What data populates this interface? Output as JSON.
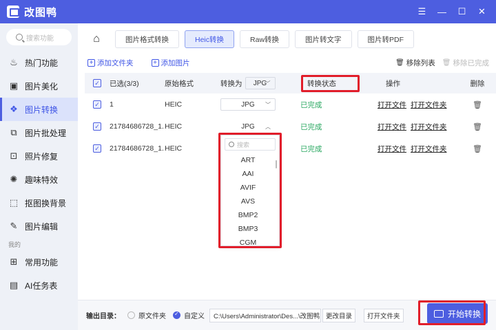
{
  "titlebar": {
    "title": "改图鸭",
    "icons": [
      "menu-icon",
      "minimize-icon",
      "maximize-icon",
      "close-icon"
    ]
  },
  "sidebar": {
    "search_placeholder": "搜索功能",
    "items": [
      {
        "label": "热门功能",
        "icon": "fire-icon"
      },
      {
        "label": "图片美化",
        "icon": "image-icon"
      },
      {
        "label": "图片转换",
        "icon": "convert-icon",
        "active": true
      },
      {
        "label": "图片批处理",
        "icon": "batch-icon"
      },
      {
        "label": "照片修复",
        "icon": "repair-icon"
      },
      {
        "label": "趣味特效",
        "icon": "effects-icon"
      },
      {
        "label": "抠图换背景",
        "icon": "cutout-icon"
      },
      {
        "label": "图片编辑",
        "icon": "edit-icon"
      }
    ],
    "group_label": "我的",
    "my_items": [
      {
        "label": "常用功能",
        "icon": "grid-icon"
      },
      {
        "label": "AI任务表",
        "icon": "task-icon"
      }
    ]
  },
  "tabs": [
    "图片格式转换",
    "Heic转换",
    "Raw转换",
    "图片转文字",
    "图片转PDF"
  ],
  "active_tab": "Heic转换",
  "toolbar": {
    "add_folder": "添加文件夹",
    "add_image": "添加图片",
    "remove_list": "移除列表",
    "remove_done": "移除已完成"
  },
  "table": {
    "headers": {
      "selected": "已选(3/3)",
      "orig_format": "原始格式",
      "convert_to": "转换为",
      "convert_to_value": "JPG",
      "status": "转换状态",
      "ops": "操作",
      "delete": "删除"
    },
    "rows": [
      {
        "name": "1",
        "format": "HEIC",
        "target": "JPG",
        "status": "已完成",
        "op1": "打开文件",
        "op2": "打开文件夹"
      },
      {
        "name": "21784686728_1...",
        "format": "HEIC",
        "target": "JPG",
        "status": "已完成",
        "op1": "打开文件",
        "op2": "打开文件夹"
      },
      {
        "name": "21784686728_1...",
        "format": "HEIC",
        "target": "",
        "status": "已完成",
        "op1": "打开文件",
        "op2": "打开文件夹"
      }
    ]
  },
  "dropdown": {
    "search_placeholder": "搜索",
    "options": [
      "ART",
      "AAI",
      "AVIF",
      "AVS",
      "BMP2",
      "BMP3",
      "CGM"
    ]
  },
  "bottom": {
    "output_label": "输出目录：",
    "radio_original": "原文件夹",
    "radio_custom": "自定义",
    "path": "C:\\Users\\Administrator\\Des...\\改图鸭",
    "change_dir": "更改目录",
    "open_folder": "打开文件夹",
    "start": "开始转换"
  },
  "colors": {
    "accent": "#4d5ee0",
    "highlight_frame": "#e11d2a",
    "done": "#2aa861"
  }
}
